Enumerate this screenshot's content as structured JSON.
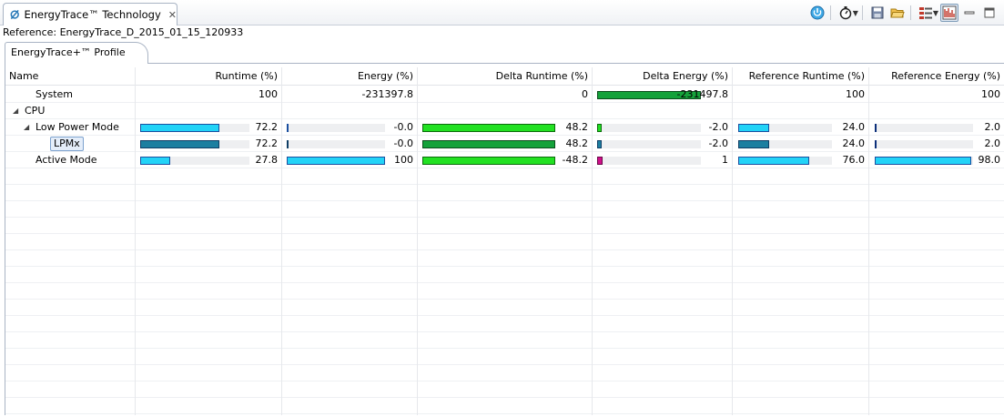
{
  "view": {
    "tab_title": "EnergyTrace™ Technology",
    "tab_close": "✕"
  },
  "toolbar": {
    "icons": [
      "power-icon",
      "stopwatch-icon",
      "save-icon",
      "open-folder-icon",
      "layout-icon",
      "energytrace-mode-icon",
      "minimize-icon",
      "maximize-icon"
    ]
  },
  "reference_label": "Reference: EnergyTrace_D_2015_01_15_120933",
  "inner_tab": "EnergyTrace+™ Profile",
  "columns": [
    {
      "label": "Name"
    },
    {
      "label": "Runtime (%)"
    },
    {
      "label": "Energy (%)"
    },
    {
      "label": "Delta Runtime (%)"
    },
    {
      "label": "Delta Energy (%)"
    },
    {
      "label": "Reference Runtime (%)"
    },
    {
      "label": "Reference Energy (%)"
    }
  ],
  "rows": [
    {
      "name": "System",
      "level": 1,
      "expander": "",
      "cells": [
        {
          "text": "100",
          "bar": null
        },
        {
          "text": "-231397.8",
          "bar": null
        },
        {
          "text": "0",
          "bar": null
        },
        {
          "text": "-231497.8",
          "bar": {
            "fraction": 1.0,
            "color": "dkgreen"
          }
        },
        {
          "text": "100",
          "bar": null
        },
        {
          "text": "100",
          "bar": null
        }
      ]
    },
    {
      "name": "CPU",
      "level": 0,
      "expander": "◢",
      "cells": [
        {
          "text": "",
          "bar": null
        },
        {
          "text": "",
          "bar": null
        },
        {
          "text": "",
          "bar": null
        },
        {
          "text": "",
          "bar": null
        },
        {
          "text": "",
          "bar": null
        },
        {
          "text": "",
          "bar": null
        }
      ]
    },
    {
      "name": "Low Power Mode",
      "level": 1,
      "expander": "◢",
      "cells": [
        {
          "text": "72.2",
          "bar": {
            "fraction": 0.722,
            "color": "cyan"
          }
        },
        {
          "text": "-0.0",
          "bar": {
            "fraction": 0.01,
            "color": "cyan"
          }
        },
        {
          "text": "48.2",
          "bar": {
            "fraction": 1.0,
            "color": "green"
          }
        },
        {
          "text": "-2.0",
          "bar": {
            "fraction": 0.04,
            "color": "green"
          }
        },
        {
          "text": "24.0",
          "bar": {
            "fraction": 0.33,
            "color": "cyan"
          }
        },
        {
          "text": "2.0",
          "bar": {
            "fraction": 0.02,
            "color": "blue"
          }
        }
      ]
    },
    {
      "name": "LPMx",
      "level": 2,
      "expander": "",
      "selected": true,
      "cells": [
        {
          "text": "72.2",
          "bar": {
            "fraction": 0.722,
            "color": "teal"
          }
        },
        {
          "text": "-0.0",
          "bar": {
            "fraction": 0.01,
            "color": "teal"
          }
        },
        {
          "text": "48.2",
          "bar": {
            "fraction": 1.0,
            "color": "dkgreen"
          }
        },
        {
          "text": "-2.0",
          "bar": {
            "fraction": 0.04,
            "color": "teal"
          }
        },
        {
          "text": "24.0",
          "bar": {
            "fraction": 0.33,
            "color": "teal"
          }
        },
        {
          "text": "2.0",
          "bar": {
            "fraction": 0.02,
            "color": "blue"
          }
        }
      ]
    },
    {
      "name": "Active Mode",
      "level": 1,
      "expander": "",
      "cells": [
        {
          "text": "27.8",
          "bar": {
            "fraction": 0.278,
            "color": "cyan"
          }
        },
        {
          "text": "100",
          "bar": {
            "fraction": 1.0,
            "color": "cyan"
          }
        },
        {
          "text": "-48.2",
          "bar": {
            "fraction": 1.0,
            "color": "green"
          }
        },
        {
          "text": "1",
          "bar": {
            "fraction": 0.05,
            "color": "magenta"
          }
        },
        {
          "text": "76.0",
          "bar": {
            "fraction": 0.76,
            "color": "cyan"
          }
        },
        {
          "text": "98.0",
          "bar": {
            "fraction": 0.98,
            "color": "cyan"
          }
        }
      ]
    }
  ]
}
